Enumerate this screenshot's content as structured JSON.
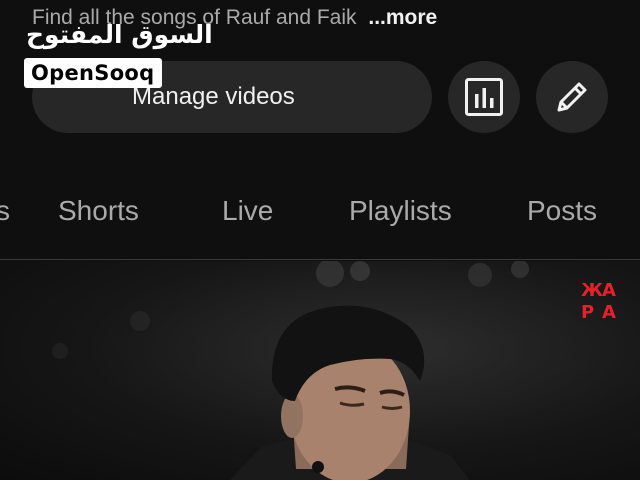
{
  "channel": {
    "description": "Find all the songs of Rauf and Faik",
    "more_label": "...more"
  },
  "watermark": {
    "arabic": "السوق المفتوح",
    "badge": "OpenSooq"
  },
  "actions": {
    "manage_videos_label": "Manage videos",
    "analytics_icon": "bar-chart-icon",
    "edit_icon": "pencil-icon"
  },
  "tabs": [
    {
      "label": "s"
    },
    {
      "label": "Shorts"
    },
    {
      "label": "Live"
    },
    {
      "label": "Playlists"
    },
    {
      "label": "Posts"
    }
  ],
  "video": {
    "overlay_logo_letters": [
      "Ж",
      "А",
      "Р",
      "А"
    ],
    "logo_color": "#e8202a"
  },
  "colors": {
    "background": "#0f0f0f",
    "button_bg": "#272727",
    "text_primary": "#f1f1f1",
    "text_secondary": "#aaaaaa"
  }
}
